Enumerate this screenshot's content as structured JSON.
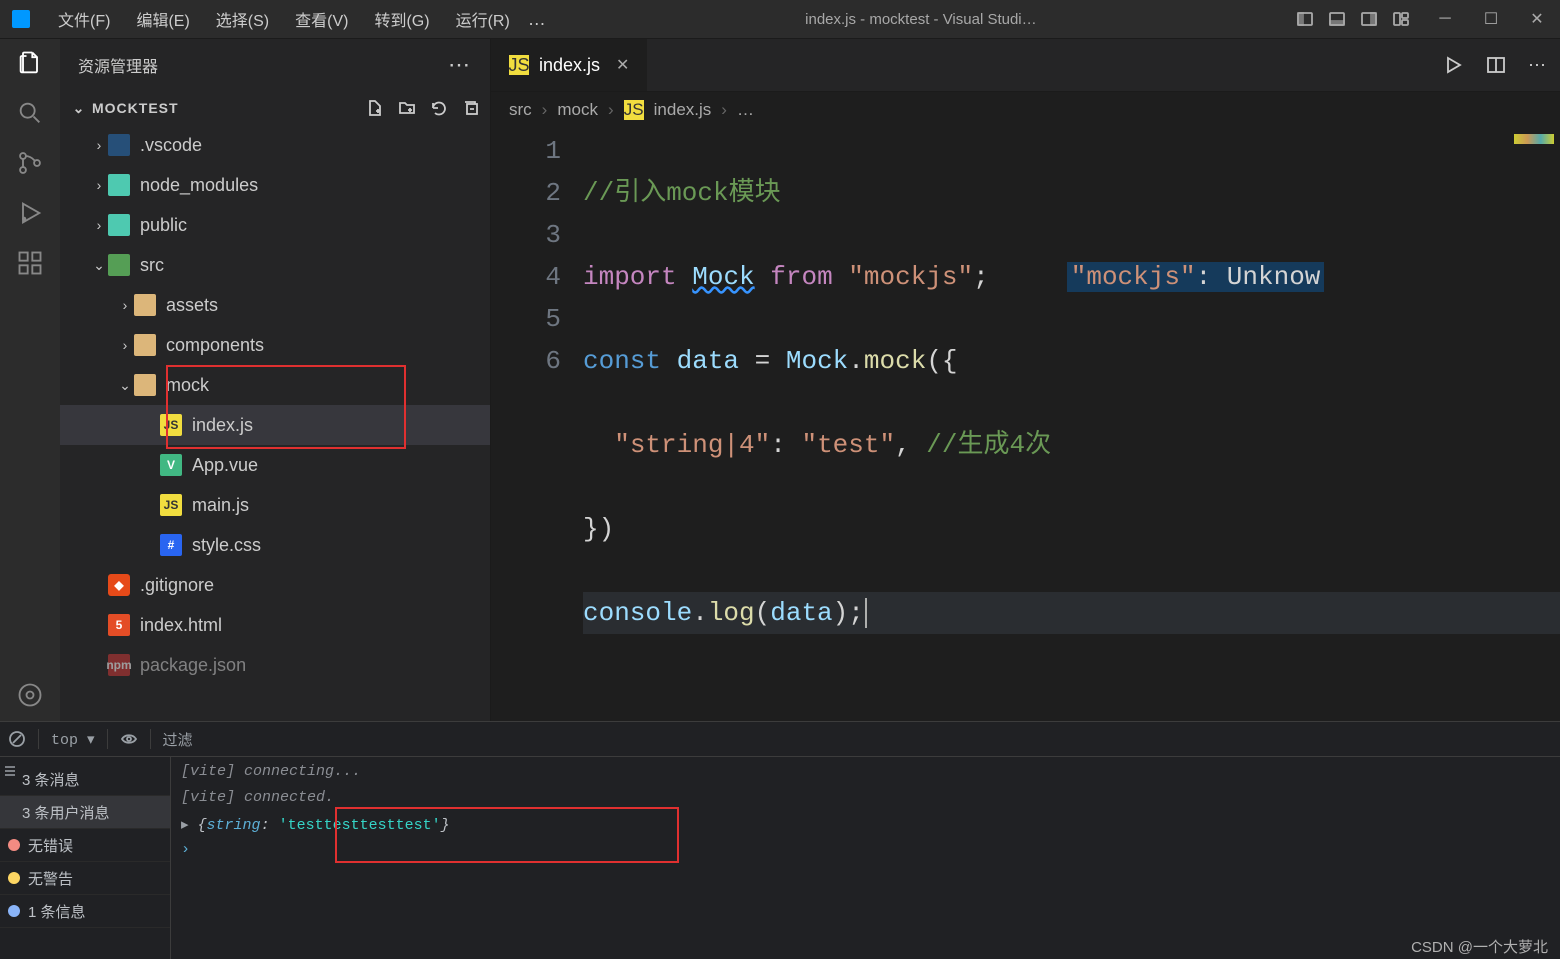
{
  "titlebar": {
    "menus": [
      "文件(F)",
      "编辑(E)",
      "选择(S)",
      "查看(V)",
      "转到(G)",
      "运行(R)"
    ],
    "overflow": "…",
    "title": "index.js - mocktest - Visual Studi…"
  },
  "sidebar": {
    "header": "资源管理器",
    "section": "MOCKTEST",
    "tree": [
      {
        "indent": 0,
        "chev": "›",
        "icon": "vscode",
        "label": ".vscode"
      },
      {
        "indent": 0,
        "chev": "›",
        "icon": "folder-teal",
        "label": "node_modules"
      },
      {
        "indent": 0,
        "chev": "›",
        "icon": "folder-teal",
        "label": "public"
      },
      {
        "indent": 0,
        "chev": "⌄",
        "icon": "folder-src",
        "label": "src"
      },
      {
        "indent": 1,
        "chev": "›",
        "icon": "folder",
        "label": "assets"
      },
      {
        "indent": 1,
        "chev": "›",
        "icon": "folder",
        "label": "components"
      },
      {
        "indent": 1,
        "chev": "⌄",
        "icon": "folder-open",
        "label": "mock",
        "hl": "box"
      },
      {
        "indent": 2,
        "chev": "",
        "icon": "js",
        "iconText": "JS",
        "label": "index.js",
        "selected": true,
        "hl": "box"
      },
      {
        "indent": 2,
        "chev": "",
        "icon": "vue",
        "iconText": "V",
        "label": "App.vue"
      },
      {
        "indent": 2,
        "chev": "",
        "icon": "js",
        "iconText": "JS",
        "label": "main.js"
      },
      {
        "indent": 2,
        "chev": "",
        "icon": "css",
        "iconText": "#",
        "label": "style.css"
      },
      {
        "indent": 0,
        "chev": "",
        "icon": "git",
        "iconText": "◆",
        "label": ".gitignore"
      },
      {
        "indent": 0,
        "chev": "",
        "icon": "html",
        "iconText": "5",
        "label": "index.html"
      },
      {
        "indent": 0,
        "chev": "",
        "icon": "npm",
        "iconText": "npm",
        "label": "package.json",
        "cut": true
      }
    ]
  },
  "editor": {
    "tab_icon": "JS",
    "tab_label": "index.js",
    "breadcrumb": [
      "src",
      "mock",
      "index.js",
      "…"
    ],
    "breadcrumb_icon": "JS",
    "line_numbers": [
      "1",
      "2",
      "3",
      "4",
      "5",
      "6"
    ],
    "code": {
      "l1_comment": "//引入mock模块",
      "l2_import": "import",
      "l2_mock": "Mock",
      "l2_from": "from",
      "l2_str": "\"mockjs\"",
      "l2_semi": ";",
      "l2_hint_key": "\"mockjs\"",
      "l2_hint_rest": ": Unknow",
      "l3_const": "const",
      "l3_data": "data",
      "l3_eq": " = ",
      "l3_Mock": "Mock",
      "l3_dot": ".",
      "l3_mockfn": "mock",
      "l3_open": "({",
      "l4_key": "\"string|4\"",
      "l4_colon": ": ",
      "l4_val": "\"test\"",
      "l4_comma": ",",
      "l4_comment": " //生成4次",
      "l5_close": "})",
      "l6_console": "console",
      "l6_dot": ".",
      "l6_log": "log",
      "l6_open": "(",
      "l6_arg": "data",
      "l6_close": ");"
    }
  },
  "devtools": {
    "top_label": "top ▾",
    "filter_placeholder": "过滤",
    "sidebar": [
      {
        "label": "3 条消息"
      },
      {
        "label": "3 条用户消息",
        "sel": true
      },
      {
        "dot": "red",
        "label": "无错误"
      },
      {
        "dot": "yellow",
        "label": "无警告"
      },
      {
        "dot": "blue",
        "label": "1 条信息"
      }
    ],
    "console": {
      "l1": "[vite] connecting...",
      "l2": "[vite] connected.",
      "obj_key": "string",
      "obj_val": "'testtesttesttest'"
    }
  },
  "credit": "CSDN @一个大萝北"
}
